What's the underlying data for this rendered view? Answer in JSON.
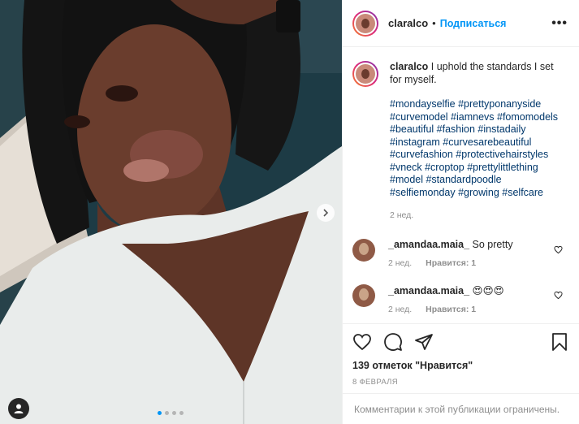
{
  "post": {
    "username": "claralco",
    "separator": "•",
    "follow_label": "Подписаться",
    "more_label": "•••"
  },
  "caption": {
    "username": "claralco",
    "text": "I uphold the standards I set for myself.",
    "hashtags": "#mondayselfie #prettyponanyside #curvemodel #iamnevs #fomomodels #beautiful #fashion #instadaily #instagram #curvesarebeautiful #curvefashion #protectivehairstyles #vneck #croptop #prettylittlething #model #standardpoodle #selfiemonday #growing #selfcare",
    "time": "2 нед."
  },
  "comments": [
    {
      "username": "_amandaa.maia_",
      "text": "So pretty",
      "time": "2 нед.",
      "likes": "Нравится: 1"
    },
    {
      "username": "_amandaa.maia_",
      "text": "😍😍😍",
      "time": "2 нед.",
      "likes": "Нравится: 1"
    }
  ],
  "actions": {
    "likes_text": "139 отметок \"Нравится\"",
    "date": "8 ФЕВРАЛЯ"
  },
  "footer": {
    "text": "Комментарии к этой публикации ограничены."
  },
  "carousel": {
    "total": 4,
    "active": 1
  },
  "colors": {
    "accent": "#0095f6",
    "hashtag": "#00376b",
    "muted": "#8e8e8e"
  },
  "icons": [
    "heart-icon",
    "comment-icon",
    "share-icon",
    "bookmark-icon",
    "chevron-right-icon",
    "user-tag-icon",
    "more-icon"
  ]
}
